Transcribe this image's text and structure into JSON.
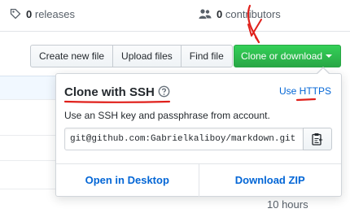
{
  "stats": {
    "releases_count": "0",
    "releases_label": "releases",
    "contributors_count": "0",
    "contributors_label": "contributors"
  },
  "toolbar": {
    "create_new_file": "Create new file",
    "upload_files": "Upload files",
    "find_file": "Find file",
    "clone_or_download": "Clone or download"
  },
  "clone_popover": {
    "title": "Clone with SSH",
    "use_https": "Use HTTPS",
    "description": "Use an SSH key and passphrase from account.",
    "url_value": "git@github.com:Gabrielkaliboy/markdown.git",
    "open_in_desktop": "Open in Desktop",
    "download_zip": "Download ZIP"
  },
  "file_list": {
    "timestamp": "10 hours"
  },
  "colors": {
    "clone_button": "#28a745",
    "link": "#0366d6",
    "annotation_red": "#e0201b"
  }
}
